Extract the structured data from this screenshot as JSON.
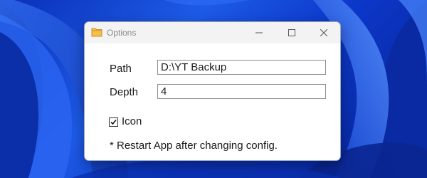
{
  "window": {
    "title": "Options",
    "icon": "folder-icon"
  },
  "caption_buttons": {
    "minimize": "minimize-icon",
    "maximize": "maximize-icon",
    "close": "close-icon"
  },
  "form": {
    "path_label": "Path",
    "path_value": "D:\\YT Backup",
    "depth_label": "Depth",
    "depth_value": "4",
    "icon_checkbox_label": "Icon",
    "icon_checkbox_checked": true,
    "note": "* Restart App after changing config."
  },
  "colors": {
    "desktop_accent": "#1d5be6",
    "window_bg": "#ffffff",
    "titlebar_bg": "#f3f3f3",
    "folder_icon": "#f4c04a"
  }
}
